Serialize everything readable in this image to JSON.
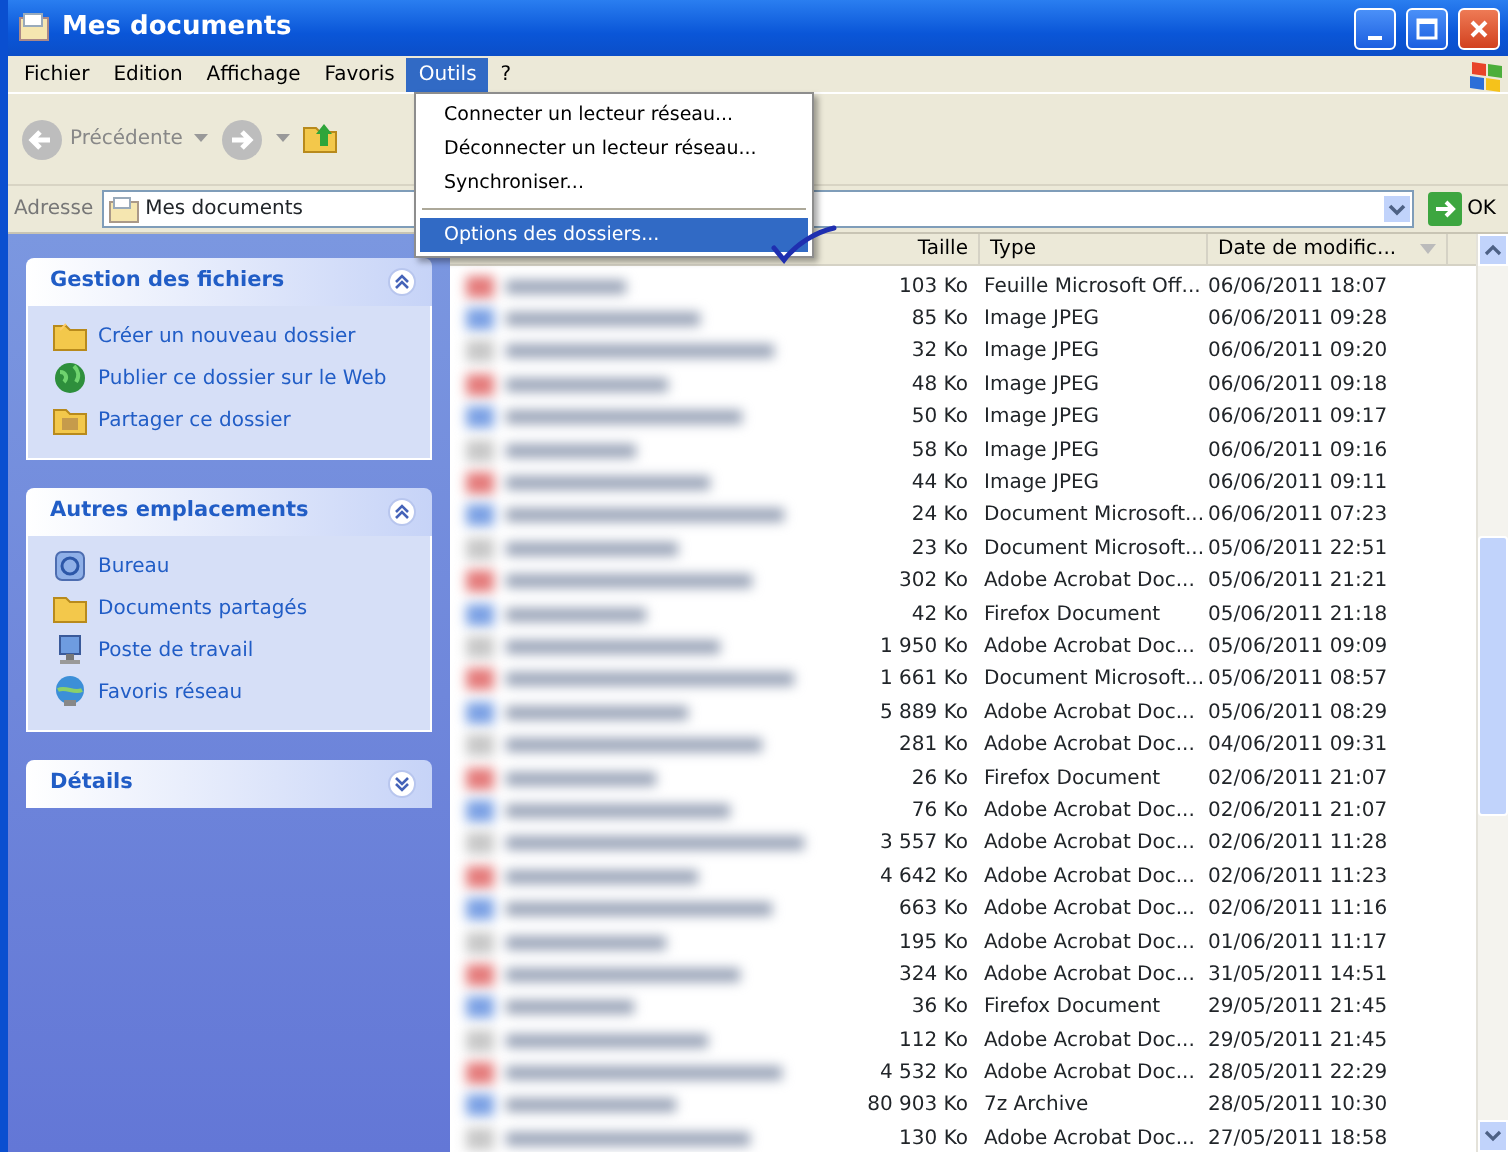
{
  "window": {
    "title": "Mes documents"
  },
  "menu_bar": [
    {
      "label": "Fichier",
      "selected": false
    },
    {
      "label": "Edition",
      "selected": false
    },
    {
      "label": "Affichage",
      "selected": false
    },
    {
      "label": "Favoris",
      "selected": false
    },
    {
      "label": "Outils",
      "selected": true
    },
    {
      "label": "?",
      "selected": false
    }
  ],
  "open_menu": [
    {
      "kind": "item",
      "label": "Connecter un lecteur réseau...",
      "selected": false
    },
    {
      "kind": "item",
      "label": "Déconnecter un lecteur réseau...",
      "selected": false
    },
    {
      "kind": "item",
      "label": "Synchroniser...",
      "selected": false
    },
    {
      "kind": "separator"
    },
    {
      "kind": "item",
      "label": "Options des dossiers...",
      "selected": true
    }
  ],
  "toolbar": {
    "back_label": "Précédente"
  },
  "address_bar": {
    "label": "Adresse",
    "value": "Mes documents",
    "go": "OK"
  },
  "sidebar": [
    {
      "title": "Gestion des fichiers",
      "expanded": true,
      "items": [
        {
          "label": "Créer un nouveau dossier",
          "kind": "new-folder"
        },
        {
          "label": "Publier ce dossier sur le Web",
          "kind": "web"
        },
        {
          "label": "Partager ce dossier",
          "kind": "share"
        }
      ]
    },
    {
      "title": "Autres emplacements",
      "expanded": true,
      "items": [
        {
          "label": "Bureau",
          "kind": "desktop"
        },
        {
          "label": "Documents partagés",
          "kind": "folder"
        },
        {
          "label": "Poste de travail",
          "kind": "computer"
        },
        {
          "label": "Favoris réseau",
          "kind": "network"
        }
      ]
    },
    {
      "title": "Détails",
      "expanded": false
    }
  ],
  "table": {
    "columns": [
      "Taille",
      "Type",
      "Date de modific..."
    ],
    "rows": [
      {
        "size": "103 Ko",
        "type": "Feuille Microsoft Off...",
        "date": "06/06/2011 18:07"
      },
      {
        "size": "85 Ko",
        "type": "Image JPEG",
        "date": "06/06/2011 09:28"
      },
      {
        "size": "32 Ko",
        "type": "Image JPEG",
        "date": "06/06/2011 09:20"
      },
      {
        "size": "48 Ko",
        "type": "Image JPEG",
        "date": "06/06/2011 09:18"
      },
      {
        "size": "50 Ko",
        "type": "Image JPEG",
        "date": "06/06/2011 09:17"
      },
      {
        "size": "58 Ko",
        "type": "Image JPEG",
        "date": "06/06/2011 09:16"
      },
      {
        "size": "44 Ko",
        "type": "Image JPEG",
        "date": "06/06/2011 09:11"
      },
      {
        "size": "24 Ko",
        "type": "Document Microsoft...",
        "date": "06/06/2011 07:23"
      },
      {
        "size": "23 Ko",
        "type": "Document Microsoft...",
        "date": "05/06/2011 22:51"
      },
      {
        "size": "302 Ko",
        "type": "Adobe Acrobat Doc...",
        "date": "05/06/2011 21:21"
      },
      {
        "size": "42 Ko",
        "type": "Firefox Document",
        "date": "05/06/2011 21:18"
      },
      {
        "size": "1 950 Ko",
        "type": "Adobe Acrobat Doc...",
        "date": "05/06/2011 09:09"
      },
      {
        "size": "1 661 Ko",
        "type": "Document Microsoft...",
        "date": "05/06/2011 08:57"
      },
      {
        "size": "5 889 Ko",
        "type": "Adobe Acrobat Doc...",
        "date": "05/06/2011 08:29"
      },
      {
        "size": "281 Ko",
        "type": "Adobe Acrobat Doc...",
        "date": "04/06/2011 09:31"
      },
      {
        "size": "26 Ko",
        "type": "Firefox Document",
        "date": "02/06/2011 21:07"
      },
      {
        "size": "76 Ko",
        "type": "Adobe Acrobat Doc...",
        "date": "02/06/2011 21:07"
      },
      {
        "size": "3 557 Ko",
        "type": "Adobe Acrobat Doc...",
        "date": "02/06/2011 11:28"
      },
      {
        "size": "4 642 Ko",
        "type": "Adobe Acrobat Doc...",
        "date": "02/06/2011 11:23"
      },
      {
        "size": "663 Ko",
        "type": "Adobe Acrobat Doc...",
        "date": "02/06/2011 11:16"
      },
      {
        "size": "195 Ko",
        "type": "Adobe Acrobat Doc...",
        "date": "01/06/2011 11:17"
      },
      {
        "size": "324 Ko",
        "type": "Adobe Acrobat Doc...",
        "date": "31/05/2011 14:51"
      },
      {
        "size": "36 Ko",
        "type": "Firefox Document",
        "date": "29/05/2011 21:45"
      },
      {
        "size": "112 Ko",
        "type": "Adobe Acrobat Doc...",
        "date": "29/05/2011 21:45"
      },
      {
        "size": "4 532 Ko",
        "type": "Adobe Acrobat Doc...",
        "date": "28/05/2011 22:29"
      },
      {
        "size": "80 903 Ko",
        "type": "7z Archive",
        "date": "28/05/2011 10:30"
      },
      {
        "size": "130 Ko",
        "type": "Adobe Acrobat Doc...",
        "date": "27/05/2011 18:58"
      }
    ]
  }
}
